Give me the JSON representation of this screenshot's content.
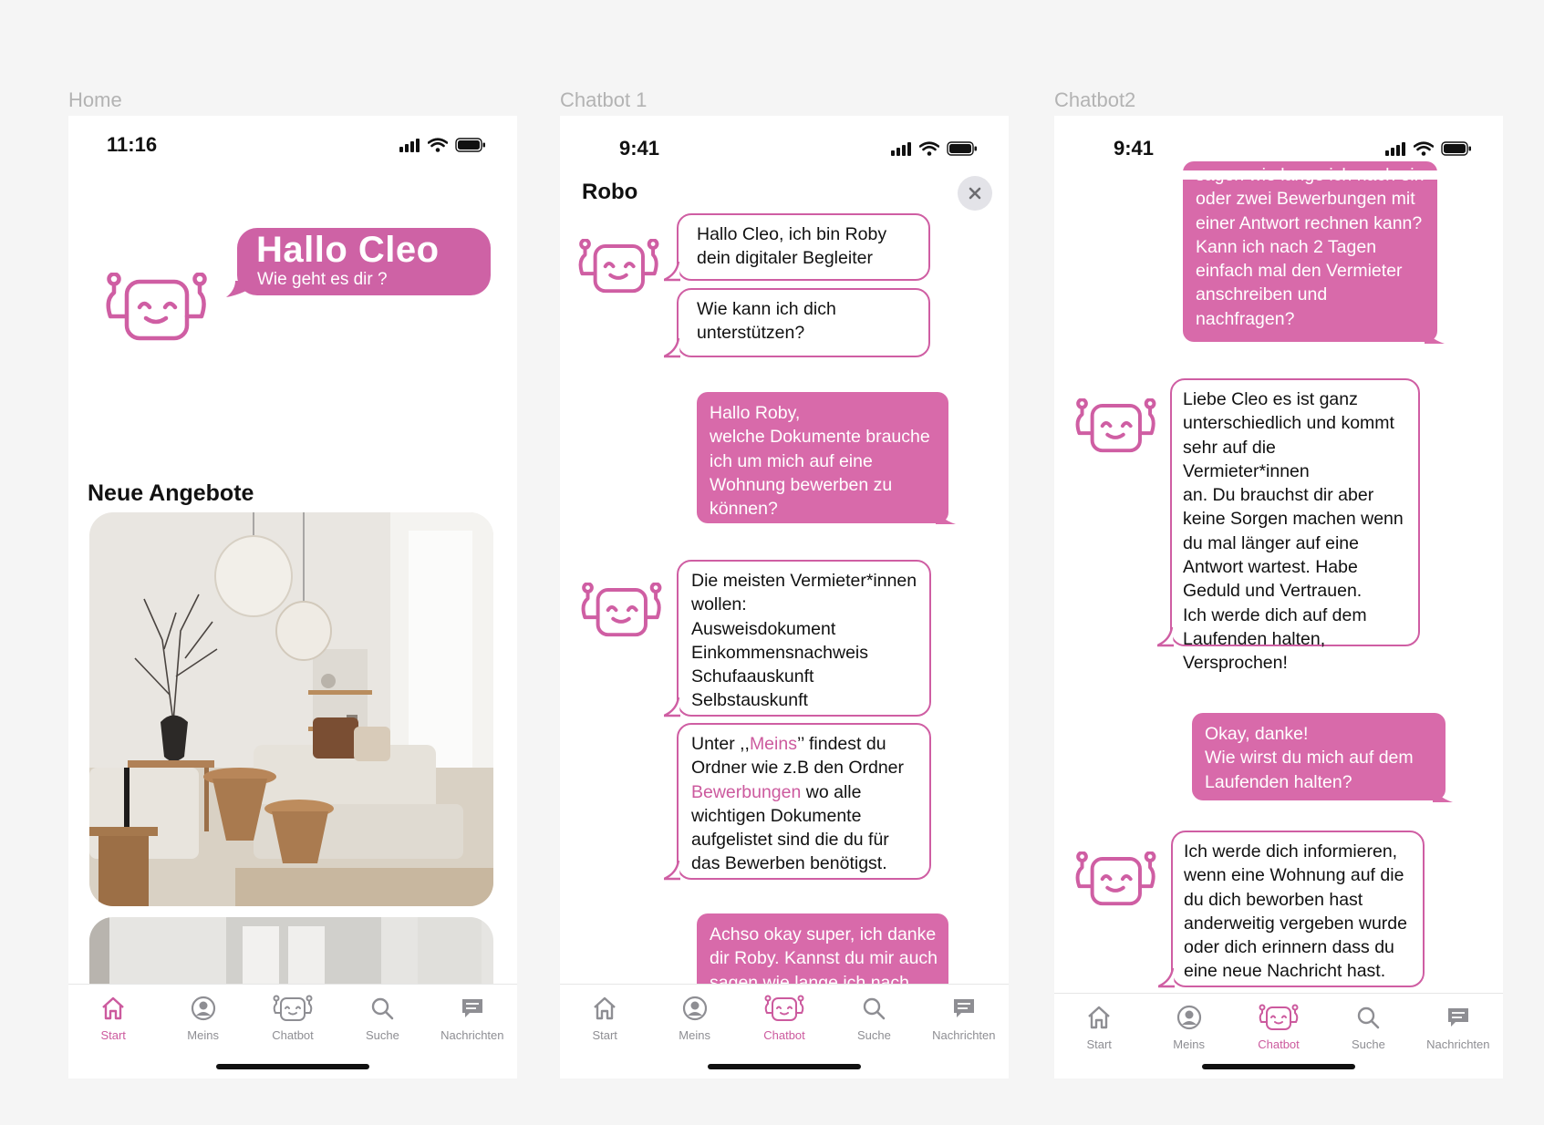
{
  "frames": {
    "home_label": "Home",
    "chat1_label": "Chatbot 1",
    "chat2_label": "Chatbot2"
  },
  "home": {
    "time": "11:16",
    "greeting_title": "Hallo Cleo",
    "greeting_sub": "Wie geht es dir ?",
    "section_title": "Neue Angebote"
  },
  "chat1": {
    "time": "9:41",
    "title": "Robo",
    "messages": [
      {
        "from": "bot",
        "text": "Hallo Cleo, ich bin Roby\ndein digitaler Begleiter"
      },
      {
        "from": "bot",
        "text": "Wie kann ich dich\nunterstützen?"
      },
      {
        "from": "user",
        "text": "Hallo Roby,\nwelche Dokumente brauche\nich um mich auf eine\nWohnung bewerben zu\nkönnen?"
      },
      {
        "from": "bot",
        "text": "Die meisten Vermieter*innen\nwollen:\nAusweisdokument\nEinkommensnachweis\nSchufaauskunft\nSelbstauskunft"
      },
      {
        "from": "bot",
        "parts": [
          "Unter ,,",
          "Meins",
          "’’ findest du\nOrdner wie z.B den Ordner\n",
          "Bewerbungen",
          " wo alle\nwichtigen Dokumente\naufgelistet sind die du für\ndas Bewerben benötigst."
        ]
      },
      {
        "from": "user",
        "text": "Achso okay super, ich danke\ndir Roby. Kannst du mir auch\nsagen wie lange ich nach ein"
      }
    ]
  },
  "chat2": {
    "time": "9:41",
    "messages": [
      {
        "from": "user",
        "text": "sagen wie lange ich nach ein\noder zwei Bewerbungen mit\neiner Antwort rechnen kann?\nKann ich nach 2 Tagen\neinfach mal den Vermieter\nanschreiben und\nnachfragen?"
      },
      {
        "from": "bot",
        "text": "Liebe Cleo es ist ganz\nunterschiedlich und kommt\nsehr auf die Vermieter*innen\nan. Du brauchst dir aber\nkeine Sorgen machen wenn\ndu mal länger auf eine\nAntwort wartest. Habe\nGeduld und Vertrauen.\nIch werde dich auf dem\nLaufenden halten,\nVersprochen!"
      },
      {
        "from": "user",
        "text": "Okay, danke!\nWie wirst du mich auf dem\nLaufenden halten?"
      },
      {
        "from": "bot",
        "text": "Ich werde dich informieren,\nwenn eine Wohnung auf die\ndu dich beworben hast\nanderweitig vergeben wurde\noder dich erinnern dass du\neine neue Nachricht hast."
      }
    ]
  },
  "tabs": [
    {
      "label": "Start",
      "icon": "house-icon"
    },
    {
      "label": "Meins",
      "icon": "person-circle-icon"
    },
    {
      "label": "Chatbot",
      "icon": "robot-icon"
    },
    {
      "label": "Suche",
      "icon": "magnifier-icon"
    },
    {
      "label": "Nachrichten",
      "icon": "message-icon"
    }
  ],
  "colors": {
    "accent": "#cc5a9e",
    "user_bubble": "#d86aaa",
    "tab_inactive": "#8e8e93"
  }
}
